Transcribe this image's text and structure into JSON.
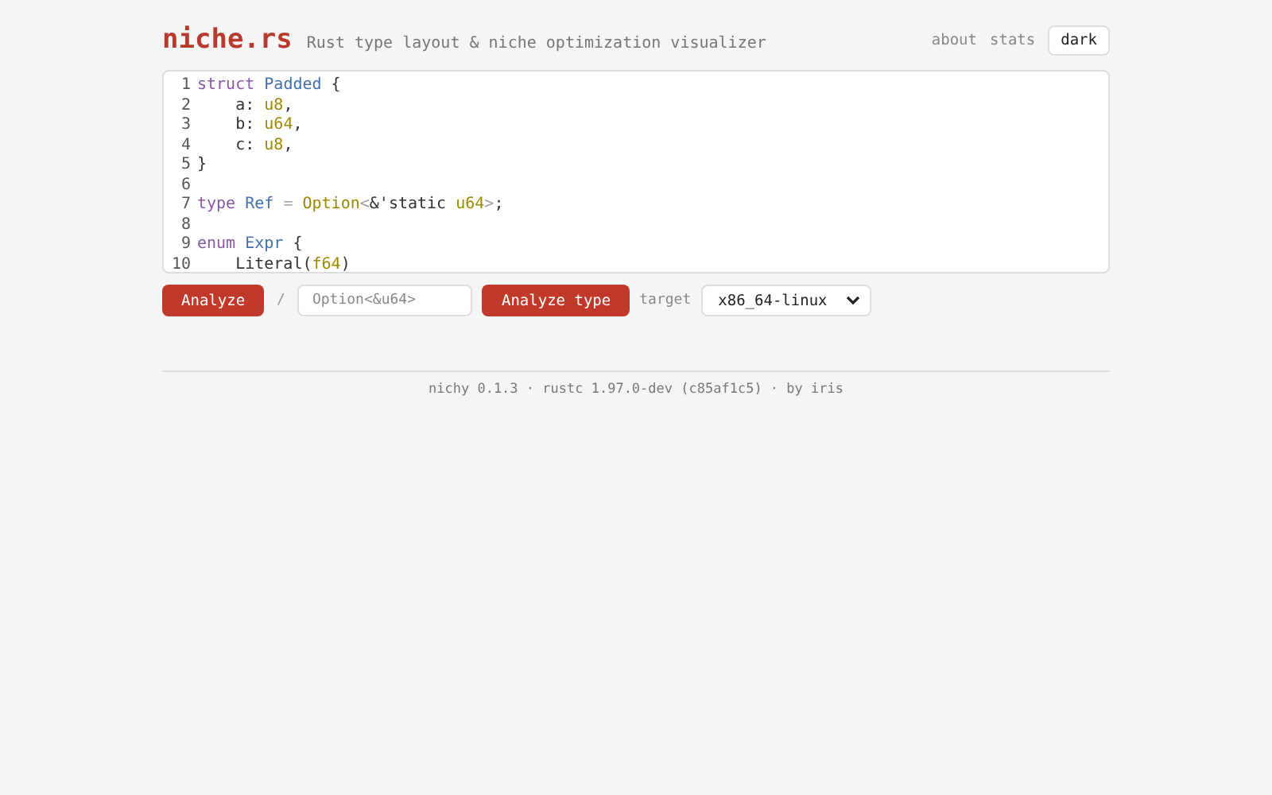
{
  "header": {
    "logo": "niche.rs",
    "tagline": "Rust type layout & niche optimization visualizer",
    "nav": [
      {
        "label": "about",
        "kind": "link"
      },
      {
        "label": "stats",
        "kind": "link"
      },
      {
        "label": "dark",
        "kind": "button"
      }
    ]
  },
  "editor": {
    "lines": [
      {
        "number": "1",
        "tokens": [
          {
            "kind": "keyword",
            "text": "struct "
          },
          {
            "kind": "name",
            "text": "Padded"
          },
          {
            "kind": "plain",
            "text": " {"
          }
        ]
      },
      {
        "number": "2",
        "tokens": [
          {
            "kind": "plain",
            "text": "    a: "
          },
          {
            "kind": "type",
            "text": "u8"
          },
          {
            "kind": "plain",
            "text": ","
          }
        ]
      },
      {
        "number": "3",
        "tokens": [
          {
            "kind": "plain",
            "text": "    b: "
          },
          {
            "kind": "type",
            "text": "u64"
          },
          {
            "kind": "plain",
            "text": ","
          }
        ]
      },
      {
        "number": "4",
        "tokens": [
          {
            "kind": "plain",
            "text": "    c: "
          },
          {
            "kind": "type",
            "text": "u8"
          },
          {
            "kind": "plain",
            "text": ","
          }
        ]
      },
      {
        "number": "5",
        "tokens": [
          {
            "kind": "plain",
            "text": "}"
          }
        ]
      },
      {
        "number": "6"
      },
      {
        "number": "7",
        "tokens": [
          {
            "kind": "keyword",
            "text": "type "
          },
          {
            "kind": "name",
            "text": "Ref "
          },
          {
            "kind": "operator",
            "text": "= "
          },
          {
            "kind": "type",
            "text": "Option"
          },
          {
            "kind": "operator",
            "text": "<"
          },
          {
            "kind": "plain",
            "text": "&'static "
          },
          {
            "kind": "type",
            "text": "u64"
          },
          {
            "kind": "operator",
            "text": ">"
          },
          {
            "kind": "plain",
            "text": ";"
          }
        ]
      },
      {
        "number": "8"
      },
      {
        "number": "9",
        "tokens": [
          {
            "kind": "keyword",
            "text": "enum "
          },
          {
            "kind": "name",
            "text": "Expr"
          },
          {
            "kind": "plain",
            "text": " {"
          }
        ]
      },
      {
        "number": "10",
        "tokens": [
          {
            "kind": "plain",
            "text": "    Literal("
          },
          {
            "kind": "type",
            "text": "f64"
          },
          {
            "kind": "plain",
            "text": ")"
          }
        ]
      }
    ]
  },
  "controls": {
    "analyze_button": "Analyze",
    "separator": "/",
    "type_field": {
      "placeholder": "Option<&u64>"
    },
    "analyze_type_button": "Analyze type",
    "target_label": "target",
    "target_select": {
      "value": "x86_64-linux"
    }
  },
  "footer": "nichy 0.1.3 · rustc 1.97.0-dev (c85af1c5) · by iris"
}
